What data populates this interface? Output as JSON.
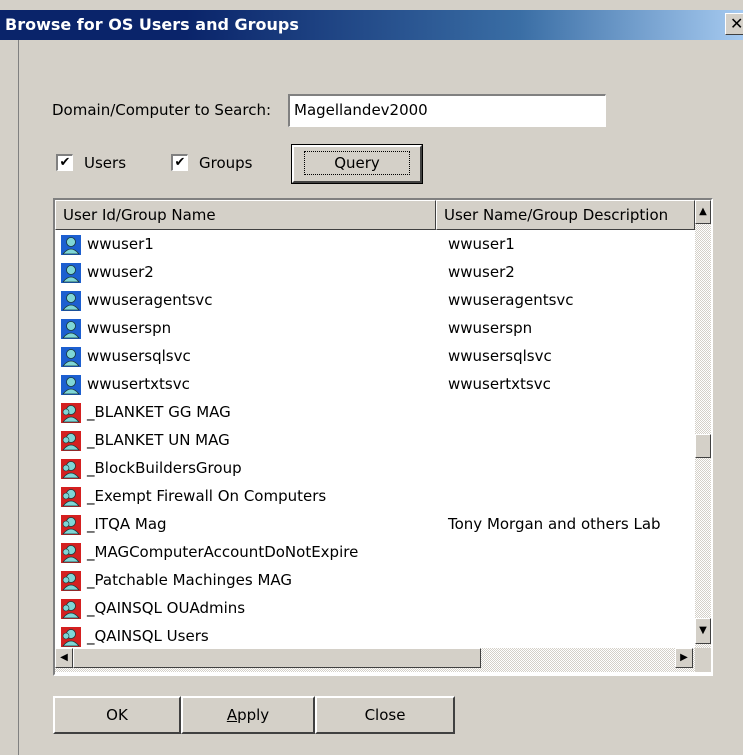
{
  "window": {
    "title": "Browse for OS Users and Groups",
    "close_glyph": "✕"
  },
  "search": {
    "label": "Domain/Computer to Search:",
    "value": "Magellandev2000"
  },
  "filters": {
    "users": {
      "label": "Users",
      "checked": true
    },
    "groups": {
      "label": "Groups",
      "checked": true
    },
    "check_glyph": "✔"
  },
  "query_button": "Query",
  "list": {
    "columns": [
      "User Id/Group Name",
      "User Name/Group Description"
    ],
    "rows": [
      {
        "name": "wwuser1",
        "desc": "wwuser1",
        "type": "user-icon"
      },
      {
        "name": "wwuser2",
        "desc": "wwuser2",
        "type": "user-icon"
      },
      {
        "name": "wwuseragentsvc",
        "desc": "wwuseragentsvc",
        "type": "user-icon"
      },
      {
        "name": "wwuserspn",
        "desc": "wwuserspn",
        "type": "user-icon"
      },
      {
        "name": "wwusersqlsvc",
        "desc": "wwusersqlsvc",
        "type": "user-icon"
      },
      {
        "name": "wwusertxtsvc",
        "desc": "wwusertxtsvc",
        "type": "user-icon"
      },
      {
        "name": "_BLANKET GG MAG",
        "desc": "",
        "type": "group-icon"
      },
      {
        "name": "_BLANKET UN MAG",
        "desc": "",
        "type": "group-icon"
      },
      {
        "name": "_BlockBuildersGroup",
        "desc": "",
        "type": "group-icon"
      },
      {
        "name": "_Exempt Firewall On Computers",
        "desc": "",
        "type": "group-icon"
      },
      {
        "name": "_ITQA Mag",
        "desc": "Tony Morgan and others Lab",
        "type": "group-icon"
      },
      {
        "name": "_MAGComputerAccountDoNotExpire",
        "desc": "",
        "type": "group-icon"
      },
      {
        "name": "_Patchable Machinges MAG",
        "desc": "",
        "type": "group-icon"
      },
      {
        "name": "_QAINSQL OUAdmins",
        "desc": "",
        "type": "group-icon"
      },
      {
        "name": "_QAINSQL Users",
        "desc": "",
        "type": "group-icon"
      }
    ],
    "scroll_glyphs": {
      "up": "▲",
      "down": "▼",
      "left": "◀",
      "right": "▶"
    }
  },
  "buttons": {
    "ok": "OK",
    "apply": "Apply",
    "close": "Close"
  },
  "colors": {
    "title_bar": "#0a246a",
    "face": "#d4d0c8",
    "user_icon": "#1c5fd0",
    "group_icon": "#d42020"
  }
}
